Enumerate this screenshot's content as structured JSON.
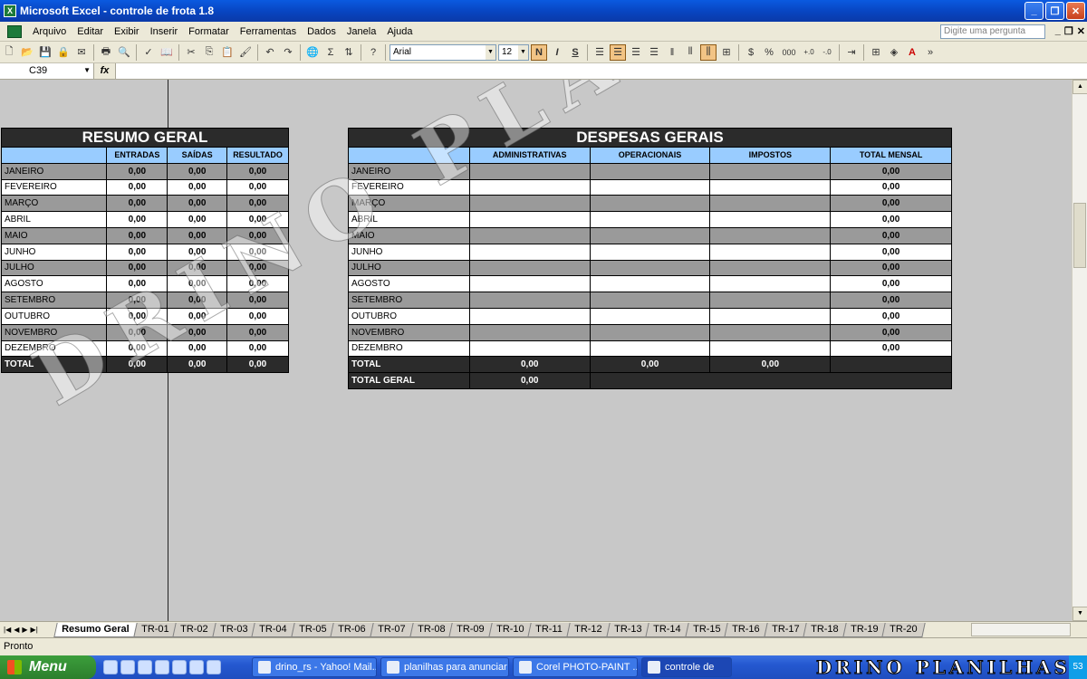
{
  "window": {
    "title": "Microsoft Excel - controle de frota 1.8",
    "icon_text": "X"
  },
  "menu": {
    "items": [
      "Arquivo",
      "Editar",
      "Exibir",
      "Inserir",
      "Formatar",
      "Ferramentas",
      "Dados",
      "Janela",
      "Ajuda"
    ],
    "question_placeholder": "Digite uma pergunta"
  },
  "toolbar": {
    "font": "Arial",
    "size": "12",
    "bold": "N",
    "italic": "I",
    "underline": "S",
    "percent": "%",
    "thousands": "000",
    "sigma": "Σ"
  },
  "formula": {
    "cell": "C39",
    "fx": "fx",
    "content": ""
  },
  "resumo": {
    "title": "RESUMO GERAL",
    "headers": [
      "",
      "ENTRADAS",
      "SAÍDAS",
      "RESULTADO"
    ],
    "rows": [
      [
        "JANEIRO",
        "0,00",
        "0,00",
        "0,00"
      ],
      [
        "FEVEREIRO",
        "0,00",
        "0,00",
        "0,00"
      ],
      [
        "MARÇO",
        "0,00",
        "0,00",
        "0,00"
      ],
      [
        "ABRIL",
        "0,00",
        "0,00",
        "0,00"
      ],
      [
        "MAIO",
        "0,00",
        "0,00",
        "0,00"
      ],
      [
        "JUNHO",
        "0,00",
        "0,00",
        "0,00"
      ],
      [
        "JULHO",
        "0,00",
        "0,00",
        "0,00"
      ],
      [
        "AGOSTO",
        "0,00",
        "0,00",
        "0,00"
      ],
      [
        "SETEMBRO",
        "0,00",
        "0,00",
        "0,00"
      ],
      [
        "OUTUBRO",
        "0,00",
        "0,00",
        "0,00"
      ],
      [
        "NOVEMBRO",
        "0,00",
        "0,00",
        "0,00"
      ],
      [
        "DEZEMBRO",
        "0,00",
        "0,00",
        "0,00"
      ]
    ],
    "total": [
      "TOTAL",
      "0,00",
      "0,00",
      "0,00"
    ]
  },
  "despesas": {
    "title": "DESPESAS GERAIS",
    "headers": [
      "",
      "ADMINISTRATIVAS",
      "OPERACIONAIS",
      "IMPOSTOS",
      "TOTAL MENSAL"
    ],
    "rows": [
      [
        "JANEIRO",
        "",
        "",
        "",
        "0,00"
      ],
      [
        "FEVEREIRO",
        "",
        "",
        "",
        "0,00"
      ],
      [
        "MARÇO",
        "",
        "",
        "",
        "0,00"
      ],
      [
        "ABRIL",
        "",
        "",
        "",
        "0,00"
      ],
      [
        "MAIO",
        "",
        "",
        "",
        "0,00"
      ],
      [
        "JUNHO",
        "",
        "",
        "",
        "0,00"
      ],
      [
        "JULHO",
        "",
        "",
        "",
        "0,00"
      ],
      [
        "AGOSTO",
        "",
        "",
        "",
        "0,00"
      ],
      [
        "SETEMBRO",
        "",
        "",
        "",
        "0,00"
      ],
      [
        "OUTUBRO",
        "",
        "",
        "",
        "0,00"
      ],
      [
        "NOVEMBRO",
        "",
        "",
        "",
        "0,00"
      ],
      [
        "DEZEMBRO",
        "",
        "",
        "",
        "0,00"
      ]
    ],
    "total": [
      "TOTAL",
      "0,00",
      "0,00",
      "0,00",
      ""
    ],
    "total_geral": [
      "TOTAL GERAL",
      "0,00"
    ]
  },
  "watermark": "DRINO PLANILHAS",
  "sheets": {
    "active": "Resumo Geral",
    "tabs": [
      "TR-01",
      "TR-02",
      "TR-03",
      "TR-04",
      "TR-05",
      "TR-06",
      "TR-07",
      "TR-08",
      "TR-09",
      "TR-10",
      "TR-11",
      "TR-12",
      "TR-13",
      "TR-14",
      "TR-15",
      "TR-16",
      "TR-17",
      "TR-18",
      "TR-19",
      "TR-20"
    ]
  },
  "status": "Pronto",
  "taskbar": {
    "start": "Menu",
    "tasks": [
      "drino_rs - Yahoo! Mail...",
      "planilhas para anunciar",
      "Corel PHOTO-PAINT ...",
      "controle de"
    ],
    "clock": "53"
  }
}
